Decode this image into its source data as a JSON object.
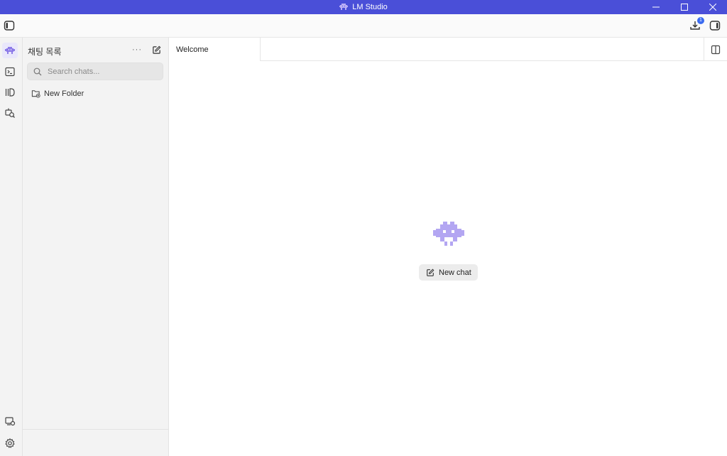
{
  "window": {
    "title": "LM Studio",
    "controls": [
      "minimize",
      "maximize",
      "close"
    ]
  },
  "toolbar": {
    "downloads_badge": "1"
  },
  "rail": {
    "items": [
      {
        "icon": "robot-icon",
        "active": true
      },
      {
        "icon": "terminal-icon",
        "active": false
      },
      {
        "icon": "library-icon",
        "active": false
      },
      {
        "icon": "discover-icon",
        "active": false
      }
    ],
    "bottom_items": [
      {
        "icon": "server-status-icon"
      },
      {
        "icon": "gear-icon"
      }
    ]
  },
  "sidebar": {
    "title": "채팅 목록",
    "more_label": "···",
    "search": {
      "placeholder": "Search chats...",
      "value": ""
    },
    "folders": [
      {
        "label": "New Folder"
      }
    ]
  },
  "tabs": [
    {
      "label": "Welcome",
      "active": true
    }
  ],
  "main": {
    "new_chat_label": "New chat"
  },
  "colors": {
    "titlebar": "#4a4fd8",
    "accent": "#8d7be8",
    "badge": "#3b6bf0"
  }
}
